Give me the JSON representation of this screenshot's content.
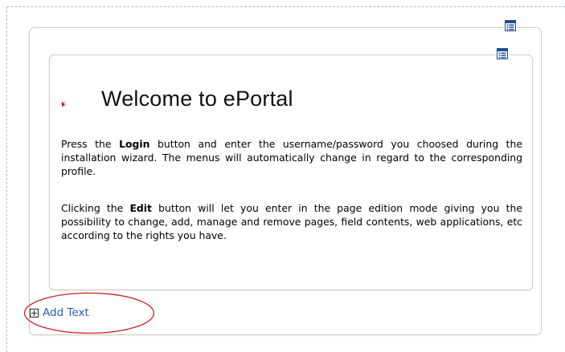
{
  "portlet": {
    "title": "Welcome to ePortal",
    "paragraph1": {
      "part1": "Press the ",
      "bold": "Login",
      "part2": " button and enter the username/password you choosed during the installation wizard. The menus will automatically change in regard to the corresponding profile."
    },
    "paragraph2": {
      "part1": "Clicking the ",
      "bold": "Edit",
      "part2": " button will let you enter in the page edition mode giving you the possibility to change, add, manage and remove pages, field contents, web applications, etc according to the rights you have."
    }
  },
  "actions": {
    "add_text_label": "Add Text"
  },
  "icons": {
    "outer_properties": "table-properties-icon",
    "inner_properties": "table-properties-icon",
    "title_bullet": "bullet-arrow-icon",
    "add_text": "plus-box-icon"
  },
  "colors": {
    "link": "#2a5db0",
    "annotation": "#cc1f1f",
    "frame_border": "#cfcdbf",
    "dashed_guide": "#a9bfd6",
    "icon_blue": "#1f4c8f"
  }
}
